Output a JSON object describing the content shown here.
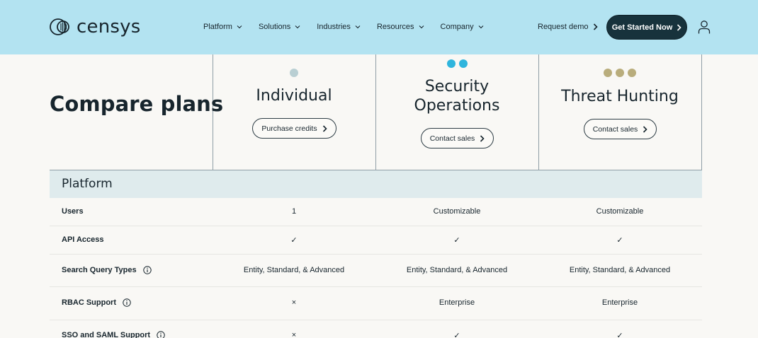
{
  "header": {
    "logo_text": "censys",
    "nav": [
      {
        "label": "Platform"
      },
      {
        "label": "Solutions"
      },
      {
        "label": "Industries"
      },
      {
        "label": "Resources"
      },
      {
        "label": "Company"
      }
    ],
    "request_demo": "Request demo",
    "get_started": "Get Started Now"
  },
  "compare": {
    "title": "Compare plans",
    "plans": [
      {
        "name": "Individual",
        "button": "Purchase credits",
        "dot_colors": [
          "#b9cfd3"
        ]
      },
      {
        "name_line1": "Security",
        "name_line2": "Operations",
        "button": "Contact sales",
        "dot_colors": [
          "#2fb5dd",
          "#2fb5dd"
        ]
      },
      {
        "name": "Threat Hunting",
        "button": "Contact sales",
        "dot_colors": [
          "#b9ad7c",
          "#b9ad7c",
          "#b9ad7c"
        ]
      }
    ]
  },
  "platform": {
    "section_label": "Platform",
    "rows": [
      {
        "label": "Users",
        "info": false,
        "values": [
          "1",
          "Customizable",
          "Customizable"
        ]
      },
      {
        "label": "API Access",
        "info": false,
        "values": [
          "✓",
          "✓",
          "✓"
        ]
      },
      {
        "label": "Search Query Types",
        "info": true,
        "values": [
          "Entity, Standard, & Advanced",
          "Entity, Standard, & Advanced",
          "Entity, Standard, & Advanced"
        ]
      },
      {
        "label": "RBAC Support",
        "info": true,
        "values": [
          "×",
          "Enterprise",
          "Enterprise"
        ]
      },
      {
        "label": "SSO and SAML Support",
        "info": true,
        "values": [
          "×",
          "✓",
          "✓"
        ]
      }
    ]
  },
  "colors": {
    "header_bg": "#b3e3f1",
    "primary_button": "#17323c",
    "band_bg": "#dfebed"
  }
}
